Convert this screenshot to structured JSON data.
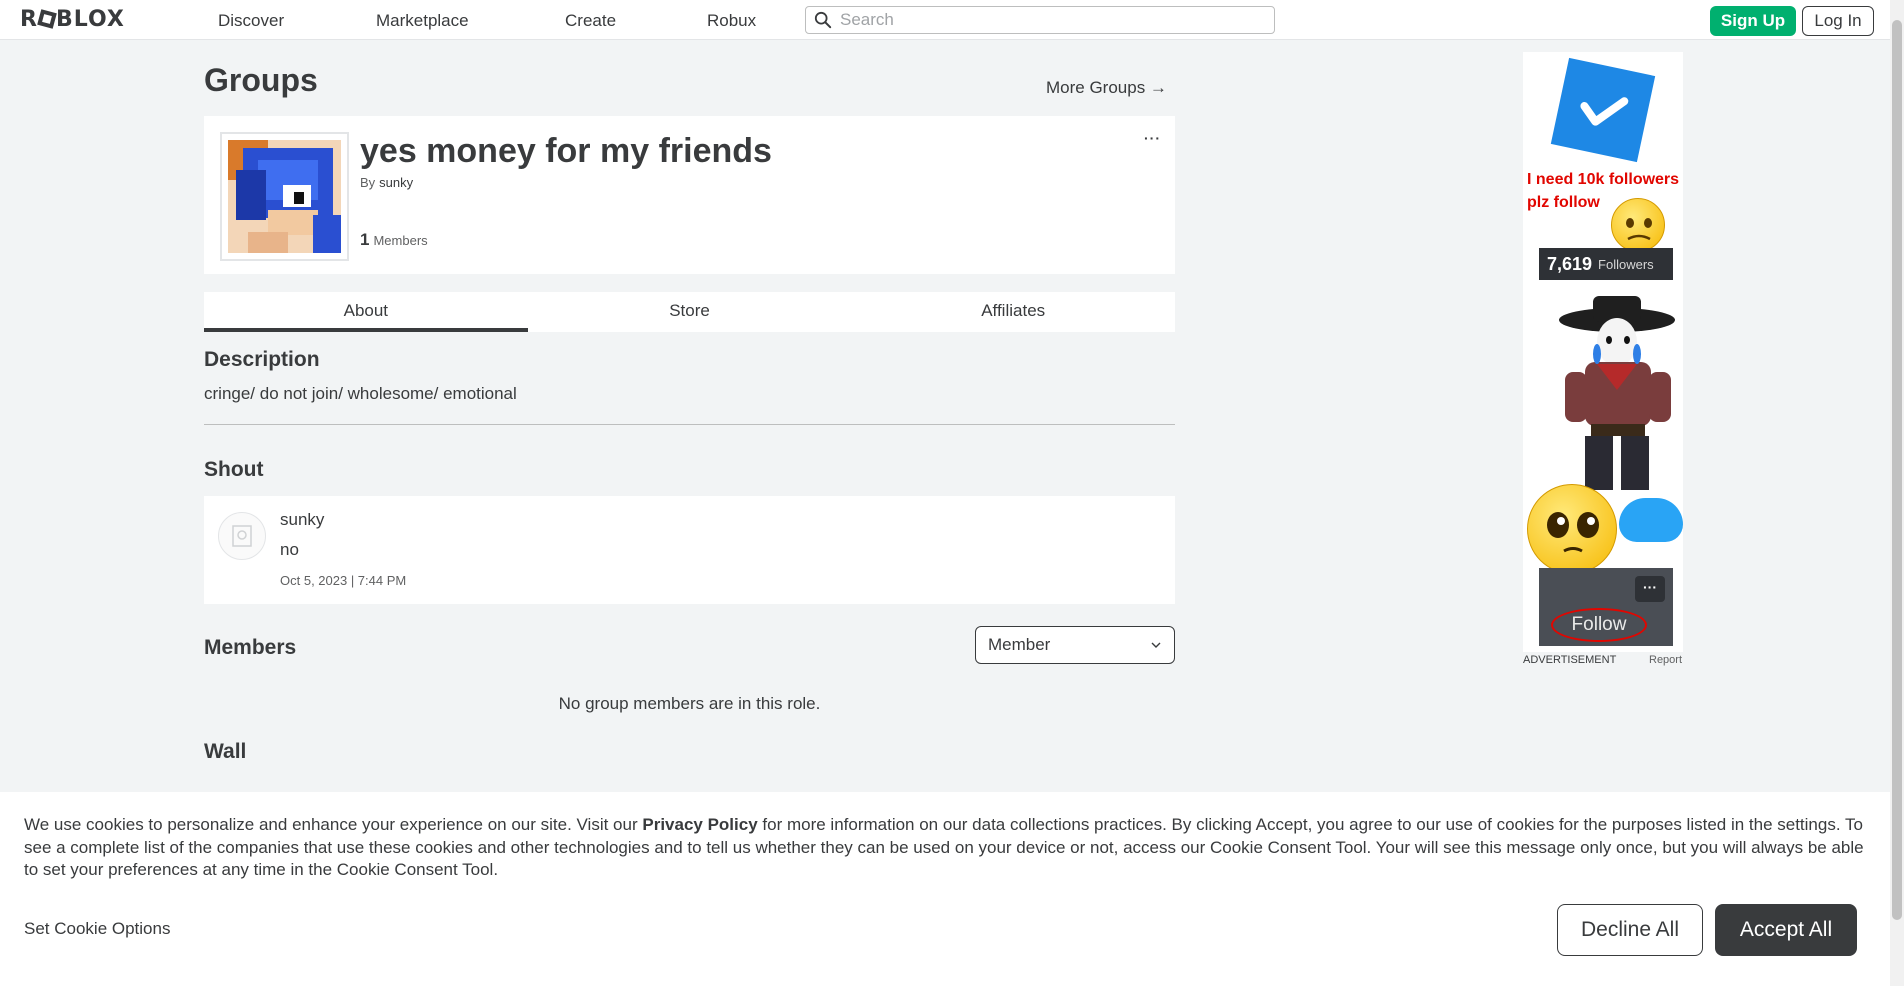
{
  "nav": {
    "logo": "ROBLOX",
    "links": [
      "Discover",
      "Marketplace",
      "Create",
      "Robux"
    ],
    "search_placeholder": "Search",
    "signup_label": "Sign Up",
    "login_label": "Log In"
  },
  "page": {
    "title": "Groups",
    "more_groups": "More Groups →"
  },
  "group": {
    "name": "yes money for my friends",
    "by_label": "By",
    "owner": "sunky",
    "member_count": "1",
    "members_label": "Members",
    "menu_glyph": "···"
  },
  "tabs": [
    {
      "label": "About",
      "active": true
    },
    {
      "label": "Store",
      "active": false
    },
    {
      "label": "Affiliates",
      "active": false
    }
  ],
  "description": {
    "title": "Description",
    "text": "cringe/ do not join/ wholesome/ emotional"
  },
  "shout": {
    "title": "Shout",
    "user": "sunky",
    "body": "no",
    "timestamp": "Oct 5, 2023 | 7:44 PM"
  },
  "members": {
    "title": "Members",
    "role_selected": "Member",
    "empty_text": "No group members are in this role."
  },
  "wall": {
    "title": "Wall"
  },
  "ad": {
    "text": "I need 10k followers plz follow",
    "followers_count": "7,619",
    "followers_label": "Followers",
    "menu_glyph": "···",
    "follow_label": "Follow",
    "advertisement_label": "ADVERTISEMENT",
    "report_label": "Report"
  },
  "cookie": {
    "text_before": "We use cookies to personalize and enhance your experience on our site. Visit our ",
    "privacy_link": "Privacy Policy",
    "text_after": " for more information on our data collections practices. By clicking Accept, you agree to our use of cookies for the purposes listed in the settings. To see a complete list of the companies that use these cookies and other technologies and to tell us whether they can be used on your device or not, access our Cookie Consent Tool. Your will see this message only once, but you will always be able to set your preferences at any time in the Cookie Consent Tool.",
    "options_label": "Set Cookie Options",
    "decline_label": "Decline All",
    "accept_label": "Accept All"
  },
  "colors": {
    "brand_green": "#00b06f",
    "text_dark": "#393b3d",
    "page_bg": "#f2f4f5",
    "ad_red": "#e10600"
  }
}
